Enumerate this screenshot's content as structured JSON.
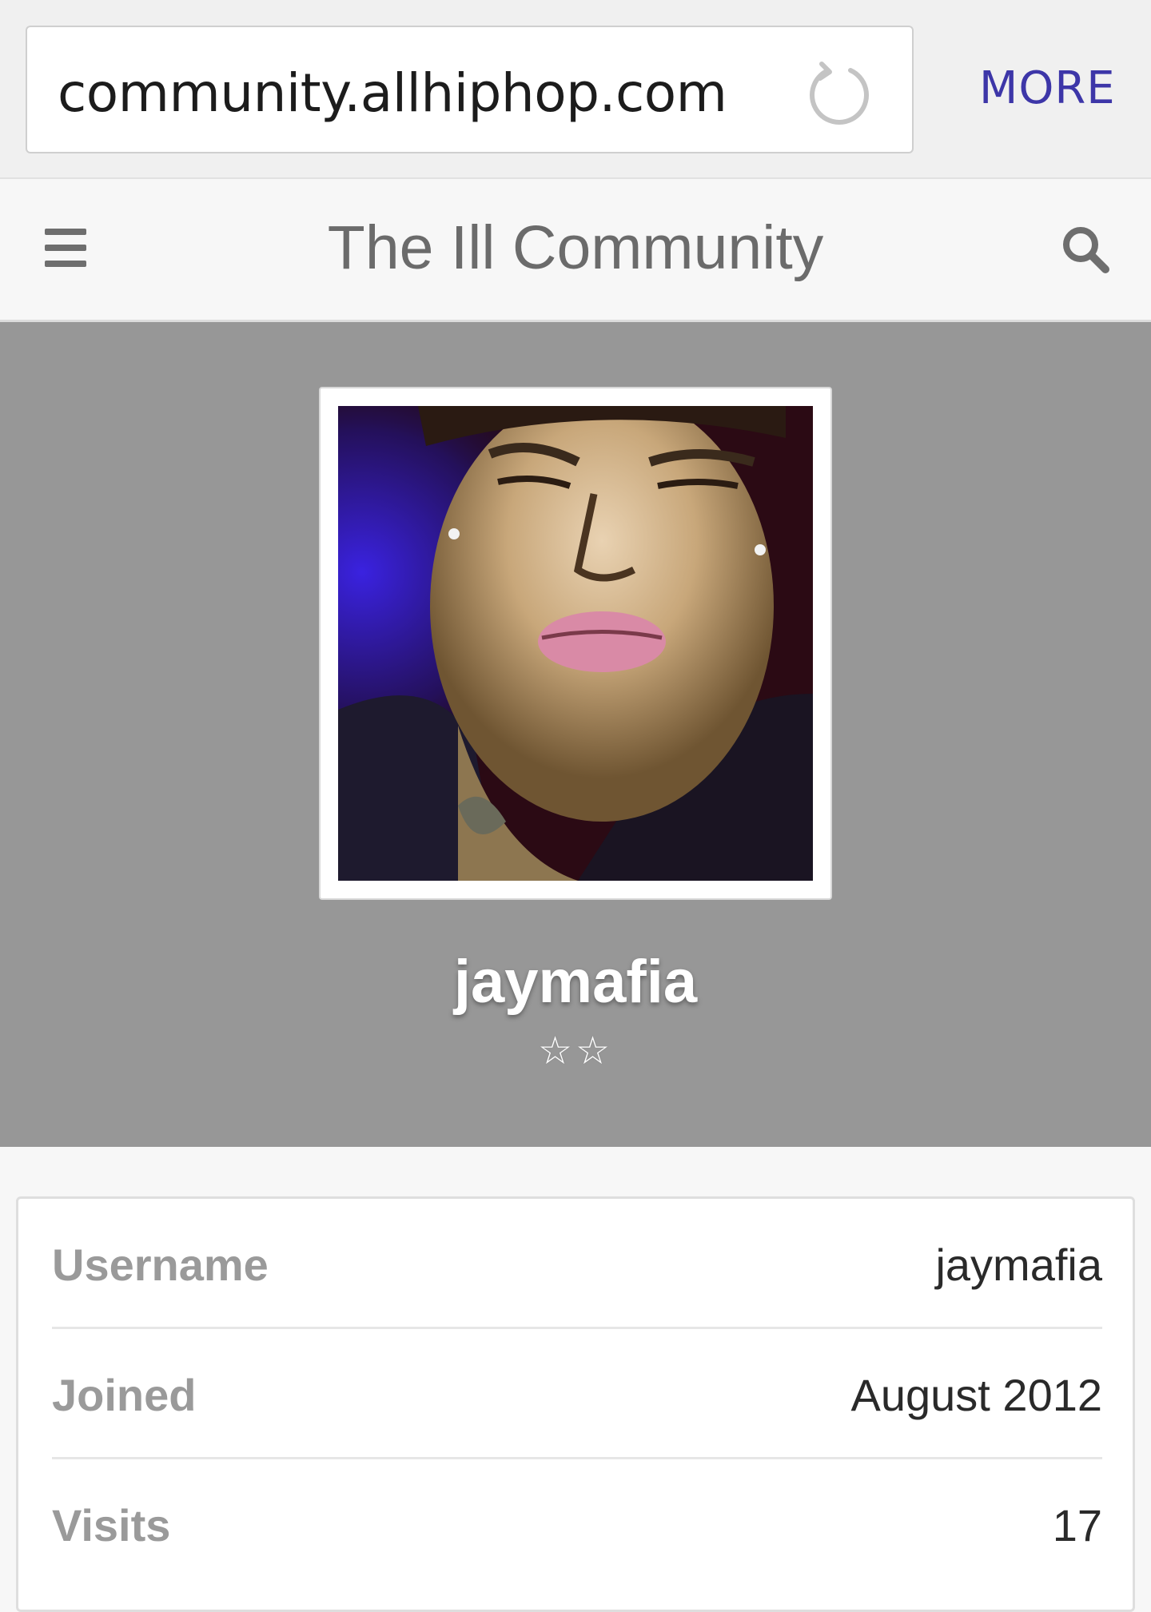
{
  "browser": {
    "url": "community.allhiphop.com",
    "more_label": "MORE",
    "reload_icon": "reload-icon",
    "accent_color": "#3d36a8"
  },
  "header": {
    "title": "The Ill Community",
    "menu_icon": "hamburger-menu-icon",
    "search_icon": "search-icon"
  },
  "profile": {
    "name": "jaymafia",
    "rank_stars": "☆☆",
    "banner_color": "#979797"
  },
  "info": {
    "rows": [
      {
        "label": "Username",
        "value": "jaymafia"
      },
      {
        "label": "Joined",
        "value": "August 2012"
      },
      {
        "label": "Visits",
        "value": "17"
      }
    ]
  }
}
